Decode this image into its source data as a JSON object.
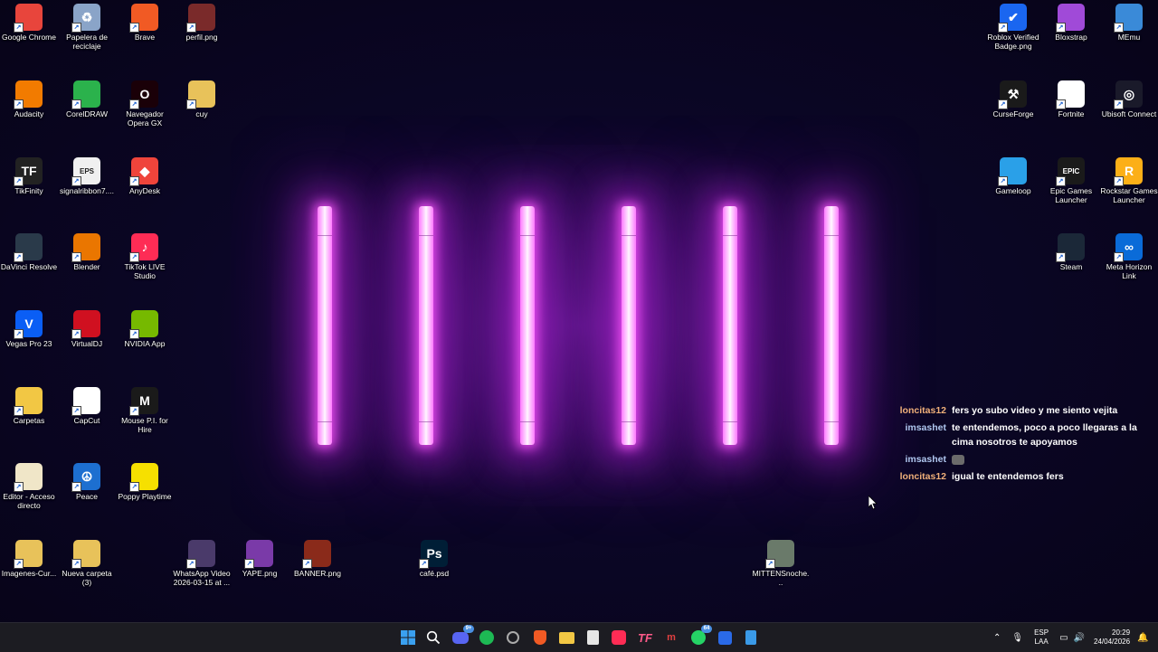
{
  "desktop": {
    "icons": [
      {
        "label": "Google Chrome",
        "glyph": "",
        "color": "#e8453c",
        "icon": "chrome-icon"
      },
      {
        "label": "Papelera de reciclaje",
        "glyph": "♻",
        "color": "#8aa4c8",
        "icon": "recycle-bin-icon"
      },
      {
        "label": "Brave",
        "glyph": "",
        "color": "#f15a24",
        "icon": "brave-icon"
      },
      {
        "label": "perfil.png",
        "glyph": "",
        "color": "#7a2a2a",
        "icon": "image-file-icon"
      },
      {
        "label": "Audacity",
        "glyph": "",
        "color": "#f27b00",
        "icon": "audacity-icon"
      },
      {
        "label": "CorelDRAW",
        "glyph": "",
        "color": "#2bb24c",
        "icon": "coreldraw-icon"
      },
      {
        "label": "Navegador Opera GX",
        "glyph": "O",
        "color": "#1a0008",
        "icon": "opera-gx-icon"
      },
      {
        "label": "cuy",
        "glyph": "",
        "color": "#e8c25a",
        "icon": "folder-icon"
      },
      {
        "label": "TikFinity",
        "glyph": "TF",
        "color": "#222222",
        "icon": "tikfinity-icon"
      },
      {
        "label": "signalribbon7....",
        "glyph": "EPS",
        "color": "#f0f0f0",
        "icon": "eps-file-icon"
      },
      {
        "label": "AnyDesk",
        "glyph": "◆",
        "color": "#ef443b",
        "icon": "anydesk-icon"
      },
      {
        "label": "DaVinci Resolve",
        "glyph": "",
        "color": "#2a3a4a",
        "icon": "davinci-resolve-icon"
      },
      {
        "label": "Blender",
        "glyph": "",
        "color": "#ea7600",
        "icon": "blender-icon"
      },
      {
        "label": "TikTok LIVE Studio",
        "glyph": "♪",
        "color": "#fe2c55",
        "icon": "tiktok-live-icon"
      },
      {
        "label": "Vegas Pro 23",
        "glyph": "V",
        "color": "#0a5ef5",
        "icon": "vegas-pro-icon"
      },
      {
        "label": "VirtualDJ",
        "glyph": "",
        "color": "#d01020",
        "icon": "virtualdj-icon"
      },
      {
        "label": "NVIDIA App",
        "glyph": "",
        "color": "#76b900",
        "icon": "nvidia-icon"
      },
      {
        "label": "Carpetas",
        "glyph": "",
        "color": "#f2c744",
        "icon": "folder-icon"
      },
      {
        "label": "CapCut",
        "glyph": "",
        "color": "#ffffff",
        "icon": "capcut-icon"
      },
      {
        "label": "Mouse P.I. for Hire",
        "glyph": "M",
        "color": "#1a1a1a",
        "icon": "mouse-pi-icon"
      },
      {
        "label": "Editor - Acceso directo",
        "glyph": "",
        "color": "#f0e6c8",
        "icon": "editor-icon"
      },
      {
        "label": "Peace",
        "glyph": "☮",
        "color": "#1d6fd0",
        "icon": "peace-icon"
      },
      {
        "label": "Poppy Playtime",
        "glyph": "",
        "color": "#f6e000",
        "icon": "poppy-playtime-icon"
      },
      {
        "label": "Imagenes-Cur...",
        "glyph": "",
        "color": "#e8c25a",
        "icon": "folder-icon"
      },
      {
        "label": "Nueva carpeta (3)",
        "glyph": "",
        "color": "#e8c25a",
        "icon": "folder-icon"
      },
      {
        "label": "WhatsApp Video 2026-03-15 at ...",
        "glyph": "",
        "color": "#4a3a6a",
        "icon": "video-file-icon"
      },
      {
        "label": "YAPE.png",
        "glyph": "",
        "color": "#7a3aa8",
        "icon": "image-file-icon"
      },
      {
        "label": "BANNER.png",
        "glyph": "",
        "color": "#8a2a1a",
        "icon": "image-file-icon"
      },
      {
        "label": "café.psd",
        "glyph": "Ps",
        "color": "#001e36",
        "icon": "photoshop-file-icon"
      },
      {
        "label": "MITTENSnoche...",
        "glyph": "",
        "color": "#6a7a6a",
        "icon": "image-file-icon"
      },
      {
        "label": "Roblox Verified Badge.png",
        "glyph": "✔",
        "color": "#1a66f0",
        "icon": "roblox-badge-icon"
      },
      {
        "label": "Bloxstrap",
        "glyph": "",
        "color": "#a04ad8",
        "icon": "bloxstrap-icon"
      },
      {
        "label": "MEmu",
        "glyph": "",
        "color": "#3a8ad8",
        "icon": "memu-icon"
      },
      {
        "label": "CurseForge",
        "glyph": "⚒",
        "color": "#1a1a1a",
        "icon": "curseforge-icon"
      },
      {
        "label": "Fortnite",
        "glyph": "",
        "color": "#ffffff",
        "icon": "file-icon"
      },
      {
        "label": "Ubisoft Connect",
        "glyph": "◎",
        "color": "#1a1a2a",
        "icon": "ubisoft-icon"
      },
      {
        "label": "Gameloop",
        "glyph": "",
        "color": "#2aa0e8",
        "icon": "gameloop-icon"
      },
      {
        "label": "Epic Games Launcher",
        "glyph": "EPIC",
        "color": "#1a1a1a",
        "icon": "epic-games-icon"
      },
      {
        "label": "Rockstar Games Launcher",
        "glyph": "R",
        "color": "#fcaf17",
        "icon": "rockstar-icon"
      },
      {
        "label": "Steam",
        "glyph": "",
        "color": "#1b2838",
        "icon": "steam-icon"
      },
      {
        "label": "Meta Horizon Link",
        "glyph": "∞",
        "color": "#0a6bd8",
        "icon": "meta-icon"
      }
    ]
  },
  "chat": {
    "messages": [
      {
        "user": "loncitas12",
        "user_color": "#f0b07a",
        "text": "fers yo subo video y me siento vejita"
      },
      {
        "user": "imsashet",
        "user_color": "#b0c8f0",
        "text": "te entendemos, poco a poco llegaras a la cima nosotros te apoyamos"
      },
      {
        "user": "imsashet",
        "user_color": "#b0c8f0",
        "text": ""
      },
      {
        "user": "loncitas12",
        "user_color": "#f0b07a",
        "text": "igual te entendemos fers"
      }
    ]
  },
  "taskbar": {
    "notifications": {
      "discord": "9+",
      "whatsapp": "64"
    },
    "language_line1": "ESP",
    "language_line2": "LAA",
    "time": "20:29",
    "date": "24/04/2026"
  }
}
